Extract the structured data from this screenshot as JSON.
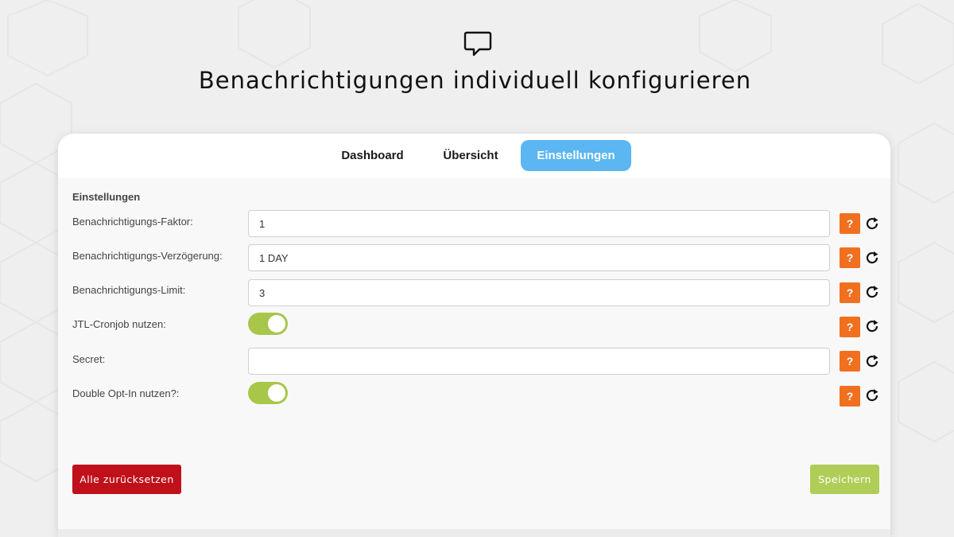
{
  "page": {
    "title": "Benachrichtigungen individuell konfigurieren",
    "header_icon": "chat-bubble-icon"
  },
  "tabs": [
    {
      "label": "Dashboard",
      "active": false
    },
    {
      "label": "Übersicht",
      "active": false
    },
    {
      "label": "Einstellungen",
      "active": true
    }
  ],
  "settings": {
    "section_title": "Einstellungen",
    "rows": [
      {
        "label": "Benachrichtigungs-Faktor:",
        "type": "text",
        "value": "1"
      },
      {
        "label": "Benachrichtigungs-Verzögerung:",
        "type": "text",
        "value": "1 DAY"
      },
      {
        "label": "Benachrichtigungs-Limit:",
        "type": "text",
        "value": "3"
      },
      {
        "label": "JTL-Cronjob nutzen:",
        "type": "toggle",
        "enabled": true
      },
      {
        "label": "Secret:",
        "type": "text",
        "value": ""
      },
      {
        "label": "Double Opt-In nutzen?:",
        "type": "toggle",
        "enabled": true
      }
    ],
    "help_label": "?",
    "help_icon": "question-icon",
    "reset_icon": "reload-icon"
  },
  "actions": {
    "reset_all_label": "Alle zurücksetzen",
    "save_label": "Speichern"
  },
  "colors": {
    "active_tab": "#5bb6f1",
    "help_button": "#f07020",
    "toggle_on": "#a8c64a",
    "reset_all_button": "#c0101a",
    "save_button": "#b0cd57"
  }
}
